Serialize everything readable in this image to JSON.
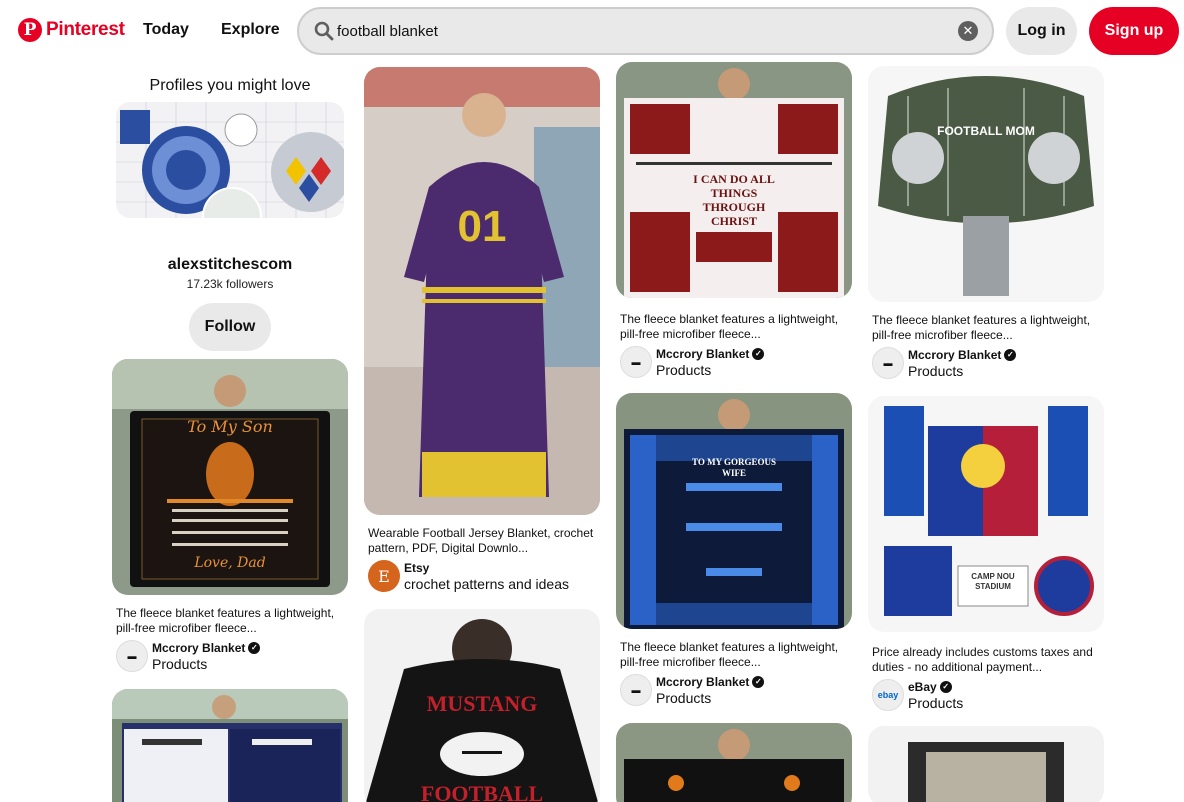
{
  "header": {
    "logo_text": "Pinterest",
    "nav_today": "Today",
    "nav_explore": "Explore",
    "search_value": "football blanket",
    "login_label": "Log in",
    "signup_label": "Sign up"
  },
  "colors": {
    "brand": "#e60023",
    "button_gray": "#e9e9e9"
  },
  "profile_card": {
    "heading": "Profiles you might love",
    "name": "alexstitchescom",
    "followers": "17.23k followers",
    "follow_label": "Follow"
  },
  "pins": {
    "col1_a": {
      "title": "The fleece blanket features a lightweight, pill-free microfiber fleece...",
      "creator": "Mccrory Blanket",
      "board": "Products"
    },
    "col2_a": {
      "title": "Wearable Football Jersey Blanket, crochet pattern, PDF, Digital Downlo...",
      "creator": "Etsy",
      "board": "crochet patterns and ideas",
      "avatar_letter": "E",
      "image_text": "01"
    },
    "col2_b": {
      "image_text_1": "MUSTANG",
      "image_text_2": "FOOTBALL"
    },
    "col3_a": {
      "title": "The fleece blanket features a lightweight, pill-free microfiber fleece...",
      "creator": "Mccrory Blanket",
      "board": "Products",
      "image_text": "I CAN DO ALL THINGS THROUGH CHRIST"
    },
    "col3_b": {
      "title": "The fleece blanket features a lightweight, pill-free microfiber fleece...",
      "creator": "Mccrory Blanket",
      "board": "Products",
      "image_text": "TO MY GORGEOUS WIFE"
    },
    "col4_a": {
      "title": "The fleece blanket features a lightweight, pill-free microfiber fleece...",
      "creator": "Mccrory Blanket",
      "board": "Products",
      "image_text": "FOOTBALL MOM"
    },
    "col4_b": {
      "title": "Price already includes customs taxes and duties - no additional payment...",
      "creator": "eBay",
      "board": "Products",
      "avatar_text": "ebay",
      "image_text": "CAMP NOU STADIUM"
    },
    "col1_son": {
      "image_text_1": "To My Son",
      "image_text_2": "Love, Dad"
    }
  }
}
